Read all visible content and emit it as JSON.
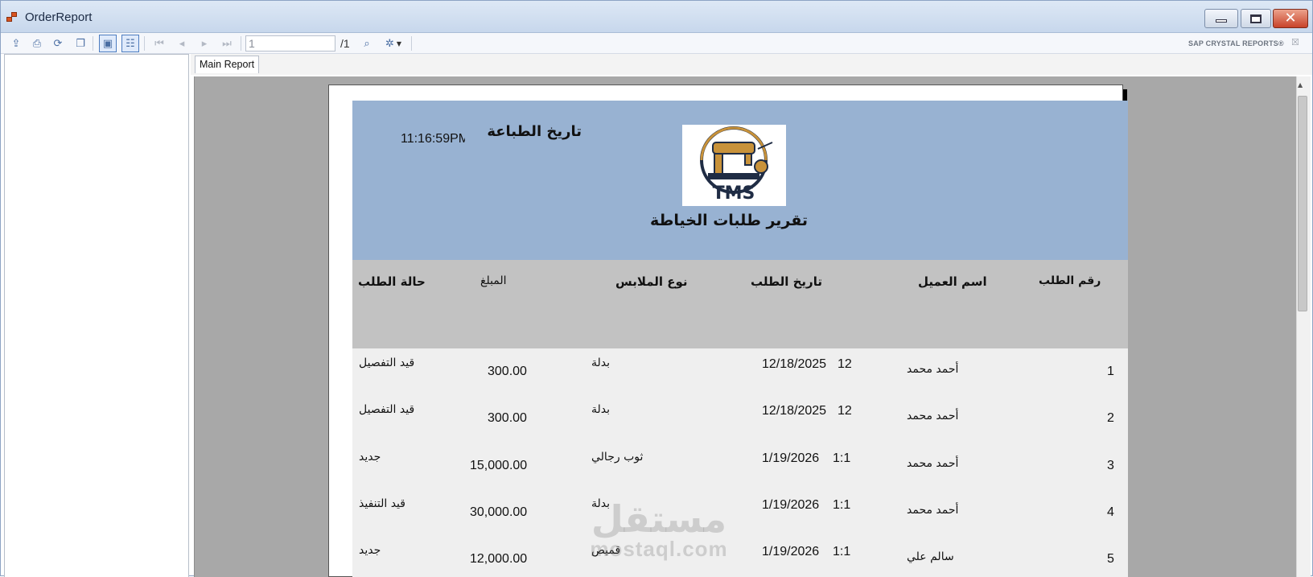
{
  "window": {
    "title": "OrderReport"
  },
  "toolbar": {
    "page_current": "1",
    "page_total": "/1",
    "brand": "SAP CRYSTAL REPORTS®",
    "icons": [
      "export-icon",
      "print-icon",
      "refresh-icon",
      "copy-icon",
      "toggle-parameter-panel-icon",
      "toggle-group-tree-icon",
      "first-page-icon",
      "previous-page-icon",
      "next-page-icon",
      "last-page-icon",
      "find-icon",
      "zoom-icon"
    ]
  },
  "tabs": {
    "main_report": "Main Report"
  },
  "report": {
    "print_label": "تاريخ الطباعة",
    "print_time": "11:16:59PM",
    "logo_text": "TMS",
    "title": "تقرير طلبات الخياطة",
    "columns": {
      "order_no": "رقم الطلب",
      "customer": "اسم العميل",
      "order_date": "تاريخ الطلب",
      "clothing_type": "نوع الملابس",
      "amount": "المبلغ",
      "status": "حالة الطلب"
    },
    "rows": [
      {
        "order_no": "1",
        "customer": "أحمد محمد",
        "date": "12/18/2025",
        "time": "12",
        "clothing_type": "بدلة",
        "amount": "300.00",
        "status": "قيد التفصيل"
      },
      {
        "order_no": "2",
        "customer": "أحمد محمد",
        "date": "12/18/2025",
        "time": "12",
        "clothing_type": "بدلة",
        "amount": "300.00",
        "status": "قيد التفصيل"
      },
      {
        "order_no": "3",
        "customer": "أحمد محمد",
        "date": "1/19/2026",
        "time": "1:1",
        "clothing_type": "ثوب رجالي",
        "amount": "15,000.00",
        "status": "جديد"
      },
      {
        "order_no": "4",
        "customer": "أحمد محمد",
        "date": "1/19/2026",
        "time": "1:1",
        "clothing_type": "بدلة",
        "amount": "30,000.00",
        "status": "قيد التنفيذ"
      },
      {
        "order_no": "5",
        "customer": "سالم علي",
        "date": "1/19/2026",
        "time": "1:1",
        "clothing_type": "قميص",
        "amount": "12,000.00",
        "status": "جديد"
      }
    ]
  },
  "watermark": {
    "arabic": "مستقل",
    "latin": "mostaql.com"
  },
  "colors": {
    "header_band": "#98b2d2",
    "column_band": "#c2c2c2",
    "body_band": "#efefef"
  }
}
